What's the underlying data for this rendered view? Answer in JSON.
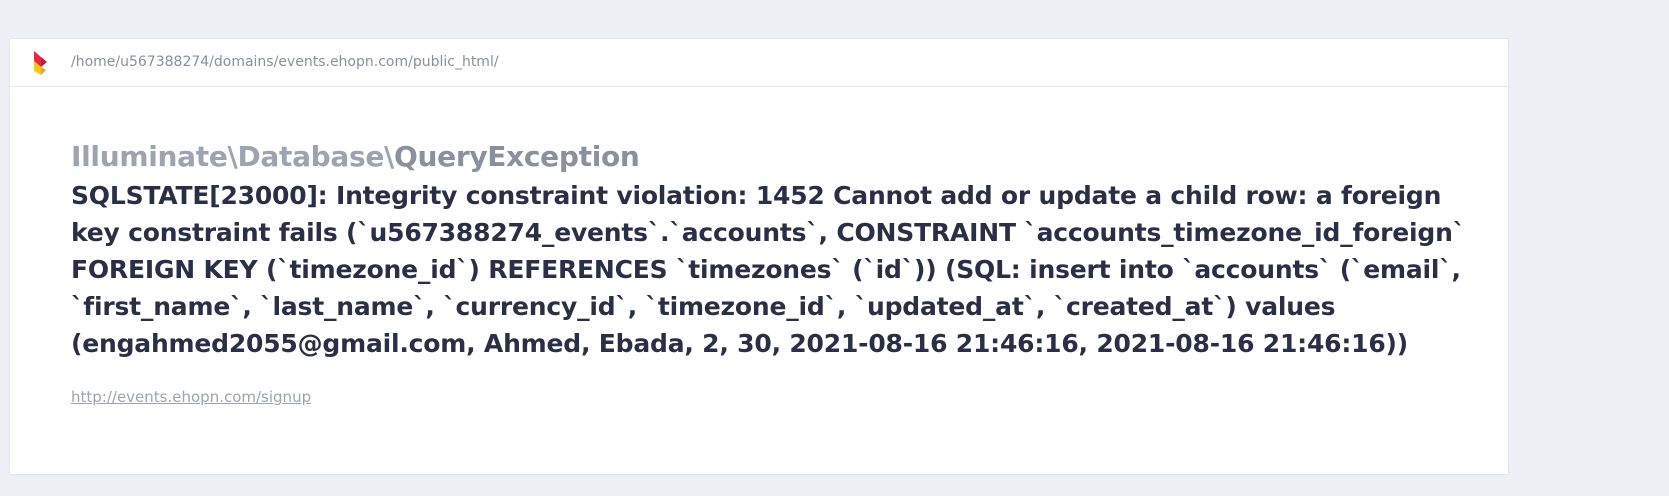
{
  "header": {
    "logo_icon": "ignition-flame-icon",
    "path": "/home/u567388274/domains/events.ehopn.com/public_html/"
  },
  "exception": {
    "class_prefix": "Illuminate\\Database\\",
    "class_name": "QueryException",
    "message": "SQLSTATE[23000]: Integrity constraint violation: 1452 Cannot add or update a child row: a foreign key constraint fails (`u567388274_events`.`accounts`, CONSTRAINT `accounts_timezone_id_foreign` FOREIGN KEY (`timezone_id`) REFERENCES `timezones` (`id`)) (SQL: insert into `accounts` (`email`, `first_name`, `last_name`, `currency_id`, `timezone_id`, `updated_at`, `created_at`) values (engahmed2055@gmail.com, Ahmed, Ebada, 2, 30, 2021-08-16 21:46:16, 2021-08-16 21:46:16))",
    "url": "http://events.ehopn.com/signup"
  },
  "colors": {
    "background": "#eef0f5",
    "card": "#ffffff",
    "message_text": "#2b2f45",
    "muted_text": "#9ea3b0",
    "logo_red": "#e8254a",
    "logo_yellow": "#f9c80e"
  }
}
